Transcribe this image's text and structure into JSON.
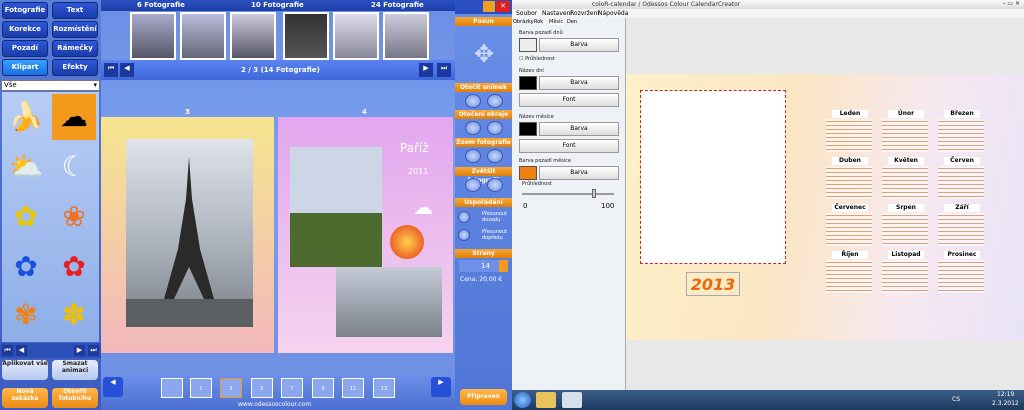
{
  "left_panel": {
    "tabs": [
      "Fotografie",
      "Text",
      "Korekce",
      "Rozmístění",
      "Pozadí",
      "Rámečky",
      "Klipart",
      "Efekty"
    ],
    "filter": "Vše",
    "cliparts": [
      "banana-icon",
      "cloud-icon",
      "sun-cloud-icon",
      "moon-cloud-icon",
      "daffodil-icon",
      "orange-flower-icon",
      "blue-flower-icon",
      "red-flower-icon",
      "orange-flower-2-icon",
      "yellow-flowers-icon"
    ],
    "apply_all": "Aplikovat vše",
    "delete_anim": "Smazat animaci",
    "new_order": "Nová zakázka",
    "open_book": "Otevřít fotoknihu"
  },
  "center": {
    "tabs": [
      "6 Fotografie",
      "10 Fotografie",
      "24 Fotografie"
    ],
    "page_status": "2 / 3 (14 Fotografie)",
    "left_page_num": "3",
    "right_page_num": "4",
    "title": "Paříž",
    "year": "2011",
    "page_thumbs": [
      "1",
      "2",
      "3",
      "4",
      "5",
      "6",
      "7",
      "8",
      "9",
      "10",
      "11",
      "12",
      "13",
      "14"
    ],
    "website": "www.odessoscolour.com"
  },
  "tools": {
    "sections": [
      "Posun",
      "Otočit snímek",
      "Otočení okraje",
      "Zoom fotografie",
      "Zvětšit fotografii",
      "Uspořádání",
      "Strany"
    ],
    "send_back": "Přesunout dozadu",
    "bring_front": "Přesunout dopředu",
    "pages": "14",
    "price": "Cena: 20,00 €",
    "prepare": "Připraven"
  },
  "calendar_app": {
    "title": "coloR-calendar / Odessos Colour CalendarCreator",
    "menu": [
      "Soubor",
      "Nastavení",
      "Rozvržení",
      "Nápověda"
    ],
    "tabs": [
      "Obrázky",
      "Rok",
      "Měsíc",
      "Den"
    ],
    "bg_day": "Barva pozadí dnů",
    "color_btn": "Barva",
    "transparent": "Průhlednost",
    "day_names": "Název dní",
    "font_btn": "Font",
    "month_name": "Název měsíce",
    "month_bg": "Barva pozadí měsíce",
    "transparency": "Průhlednost",
    "slider_min": "0",
    "slider_max": "100",
    "year_badge": "2013",
    "months": [
      "Leden",
      "Únor",
      "Březen",
      "Duben",
      "Květen",
      "Červen",
      "Červenec",
      "Srpen",
      "Září",
      "Říjen",
      "Listopad",
      "Prosinec"
    ]
  },
  "taskbar": {
    "lang": "CS",
    "time": "12:19",
    "date": "2.3.2012"
  },
  "colors": {
    "accent": "#f39a1c",
    "blue": "#2e57d8",
    "swatch_black": "#000000",
    "swatch_orange": "#f08010"
  }
}
